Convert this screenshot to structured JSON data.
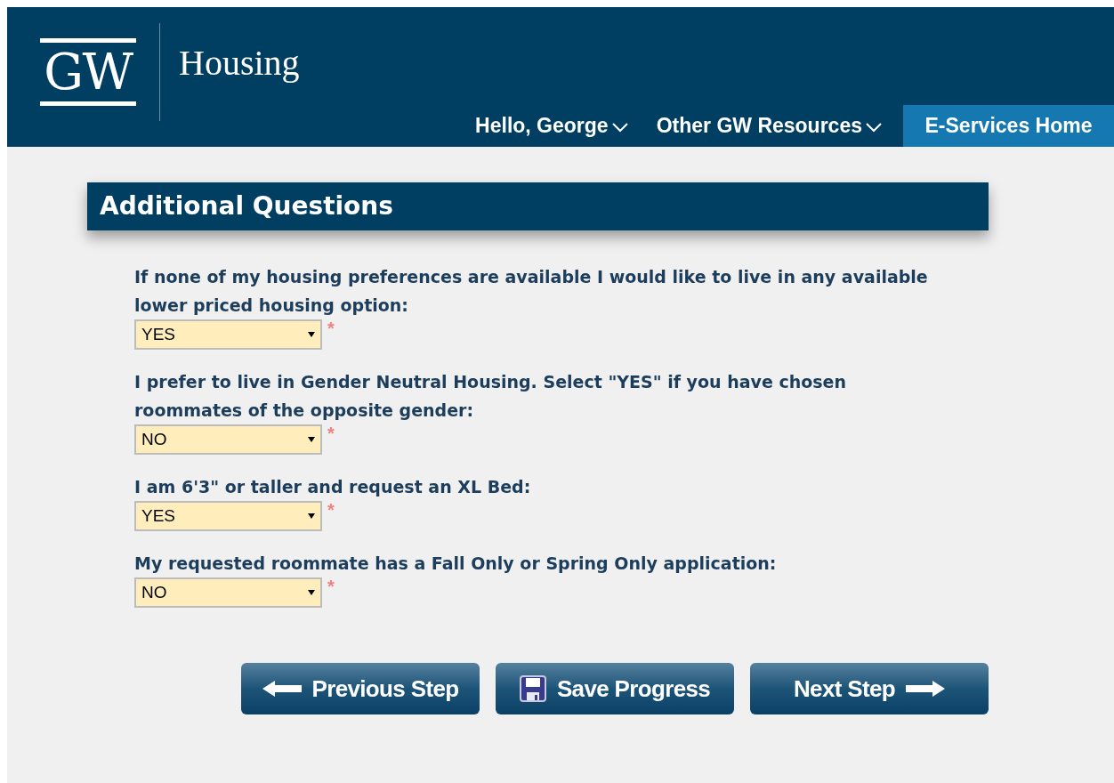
{
  "header": {
    "logo": "GW",
    "site_title": "Housing",
    "nav": [
      {
        "label": "Hello, George",
        "kind": "dropdown"
      },
      {
        "label": "Other GW Resources",
        "kind": "dropdown"
      },
      {
        "label": "E-Services Home",
        "kind": "highlight"
      }
    ]
  },
  "section": {
    "title": "Additional Questions",
    "questions": [
      {
        "label": "If none of my housing preferences are available I would like to live in any available lower priced housing option:",
        "value": "YES",
        "required_mark": "*"
      },
      {
        "label": "I prefer to live in Gender Neutral Housing. Select \"YES\" if you have chosen roommates of the opposite gender:",
        "value": "NO",
        "required_mark": "*"
      },
      {
        "label": "I am 6'3\" or taller and request an XL Bed:",
        "value": "YES",
        "required_mark": "*"
      },
      {
        "label": "My requested roommate has a Fall Only or Spring Only application:",
        "value": "NO",
        "required_mark": "*"
      }
    ]
  },
  "buttons": [
    {
      "label": "Previous Step",
      "kind": "previous"
    },
    {
      "label": "Save Progress",
      "kind": "save"
    },
    {
      "label": "Next Step",
      "kind": "next"
    }
  ]
}
